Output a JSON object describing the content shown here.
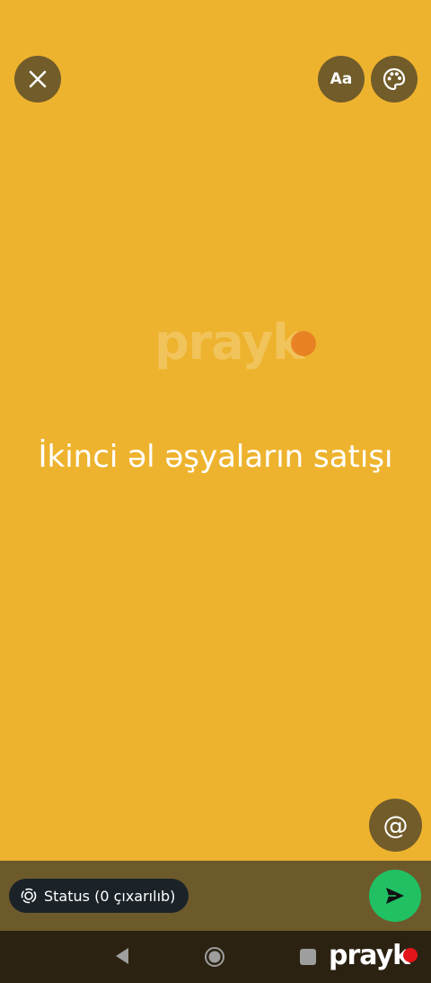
{
  "toolbar": {
    "close_icon": "close-icon",
    "font_label": "Aa",
    "palette_icon": "palette-icon"
  },
  "canvas": {
    "background_color": "#EEB32E",
    "text": "İkinci əl əşyaların satışı",
    "watermark": "prayk"
  },
  "mention": {
    "label": "@"
  },
  "composer": {
    "audience_label": "Status (0 çıxarılıb)",
    "audience_icon": "status-icon",
    "send_icon": "send-icon",
    "send_color": "#21C063"
  },
  "navigation": {
    "back_icon": "back-triangle-icon",
    "home_icon": "home-circle-icon",
    "recents_icon": "recents-square-icon",
    "brand": "prayk"
  }
}
